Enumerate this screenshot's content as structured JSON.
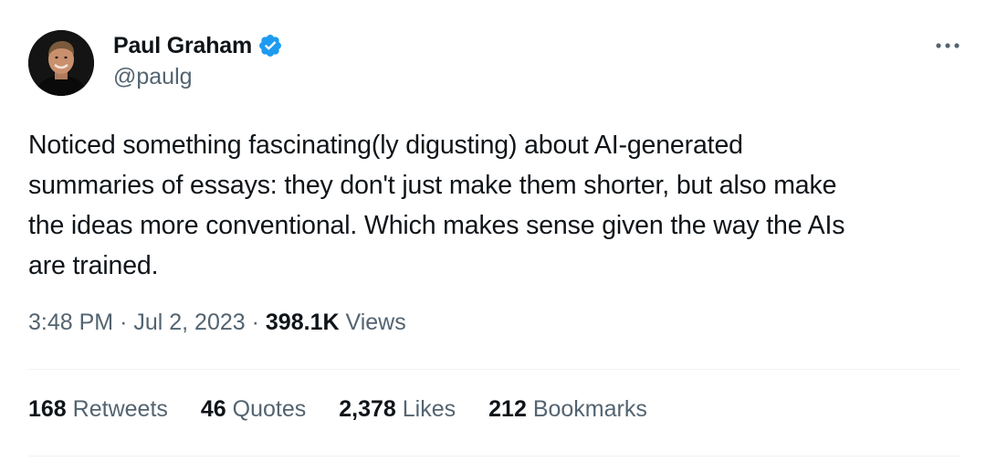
{
  "author": {
    "name": "Paul Graham",
    "handle": "@paulg",
    "verified": true,
    "avatar_icon": "profile-photo"
  },
  "tweet": {
    "text_lines": [
      "Noticed something fascinating(ly digusting) about AI-generated",
      "summaries of essays: they don't just make them shorter, but also make",
      "the ideas more conventional. Which makes sense given the way the AIs",
      "are trained."
    ]
  },
  "meta": {
    "time": "3:48 PM",
    "separator": "·",
    "date": "Jul 2, 2023",
    "views_count": "398.1K",
    "views_label": "Views"
  },
  "stats": [
    {
      "num": "168",
      "label": "Retweets"
    },
    {
      "num": "46",
      "label": "Quotes"
    },
    {
      "num": "2,378",
      "label": "Likes"
    },
    {
      "num": "212",
      "label": "Bookmarks"
    }
  ],
  "colors": {
    "text_primary": "#0f1419",
    "text_secondary": "#536471",
    "verified_blue": "#1d9bf0",
    "divider": "#eff3f4"
  },
  "icons": {
    "verified": "verified-badge-icon",
    "more": "more-options-icon"
  }
}
